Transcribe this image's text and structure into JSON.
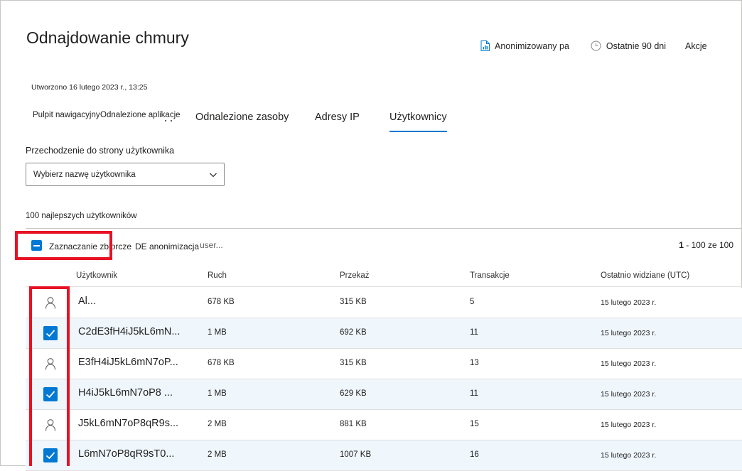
{
  "page": {
    "title": "Odnajdowanie chmury"
  },
  "toolbar": {
    "report_label": "Anonimizowany pa",
    "report_icon": "report-icon",
    "period_label": "Ostatnie 90 dni",
    "period_icon": "clock-icon",
    "actions_label": "Akcje"
  },
  "created": "Utworzono 16 lutego 2023 r., 13:25",
  "tabs": [
    {
      "label": "Pulpit nawigacyjny"
    },
    {
      "label": "Odnalezione aplikacje"
    },
    {
      "label": "Odnalezione zasoby"
    },
    {
      "label": "Adresy IP"
    },
    {
      "label": "Użytkownicy",
      "active": true
    }
  ],
  "user_nav": {
    "label": "Przechodzenie do strony użytkownika",
    "placeholder": "Wybierz nazwę użytkownika"
  },
  "top_users_label": "100 najlepszych użytkowników",
  "commands": {
    "bulk_select": "Zaznaczanie zbiorcze",
    "deanonymize": "DE anonimizacja",
    "user_more": "user...",
    "paging_range": "1",
    "paging_rest": " - 100 ze 100"
  },
  "table": {
    "columns": [
      "Użytkownik",
      "Ruch",
      "Przekaż",
      "Transakcje",
      "Ostatnio widziane (UTC)"
    ],
    "rows": [
      {
        "user": "Al...",
        "traffic": "678 KB",
        "upload": "315 KB",
        "transactions": "5",
        "last_seen": "15 lutego 2023 r.",
        "selected": false
      },
      {
        "user": "C2dE3fH4iJ5kL6mN...",
        "traffic": "1 MB",
        "upload": "692 KB",
        "transactions": "11",
        "last_seen": "15 lutego 2023 r.",
        "selected": true
      },
      {
        "user": "E3fH4iJ5kL6mN7oP...",
        "traffic": "678 KB",
        "upload": "315 KB",
        "transactions": "13",
        "last_seen": "15 lutego 2023 r.",
        "selected": false
      },
      {
        "user": "H4iJ5kL6mN7oP8 ...",
        "traffic": "1 MB",
        "upload": "629 KB",
        "transactions": "11",
        "last_seen": "15 lutego 2023 r.",
        "selected": true
      },
      {
        "user": "J5kL6mN7oP8qR9s...",
        "traffic": "2 MB",
        "upload": "881 KB",
        "transactions": "15",
        "last_seen": "15 lutego 2023 r.",
        "selected": false
      },
      {
        "user": "L6mN7oP8qR9sT0...",
        "traffic": "2 MB",
        "upload": "1007 KB",
        "transactions": "16",
        "last_seen": "15 lutego 2023 r.",
        "selected": true
      }
    ]
  },
  "colors": {
    "accent": "#0078d4",
    "highlight": "#e81123",
    "selected_row": "#eff6fc"
  }
}
